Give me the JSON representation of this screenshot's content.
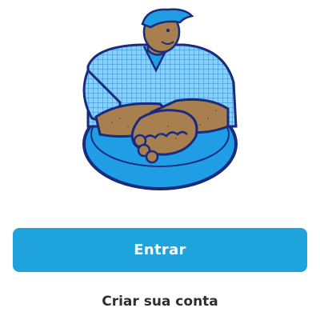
{
  "illustration": {
    "icon": "handshake-illustration-icon",
    "colors": {
      "blue": "#1f9ee6",
      "navy": "#1a2a7c",
      "skin": "#a8804f",
      "shirt_light": "#8ccff2"
    }
  },
  "actions": {
    "primary_label": "Entrar",
    "secondary_label": "Criar sua conta"
  },
  "theme": {
    "accent": "#1fa3dc",
    "text_dark": "#2f2f2f",
    "background": "#ffffff"
  }
}
